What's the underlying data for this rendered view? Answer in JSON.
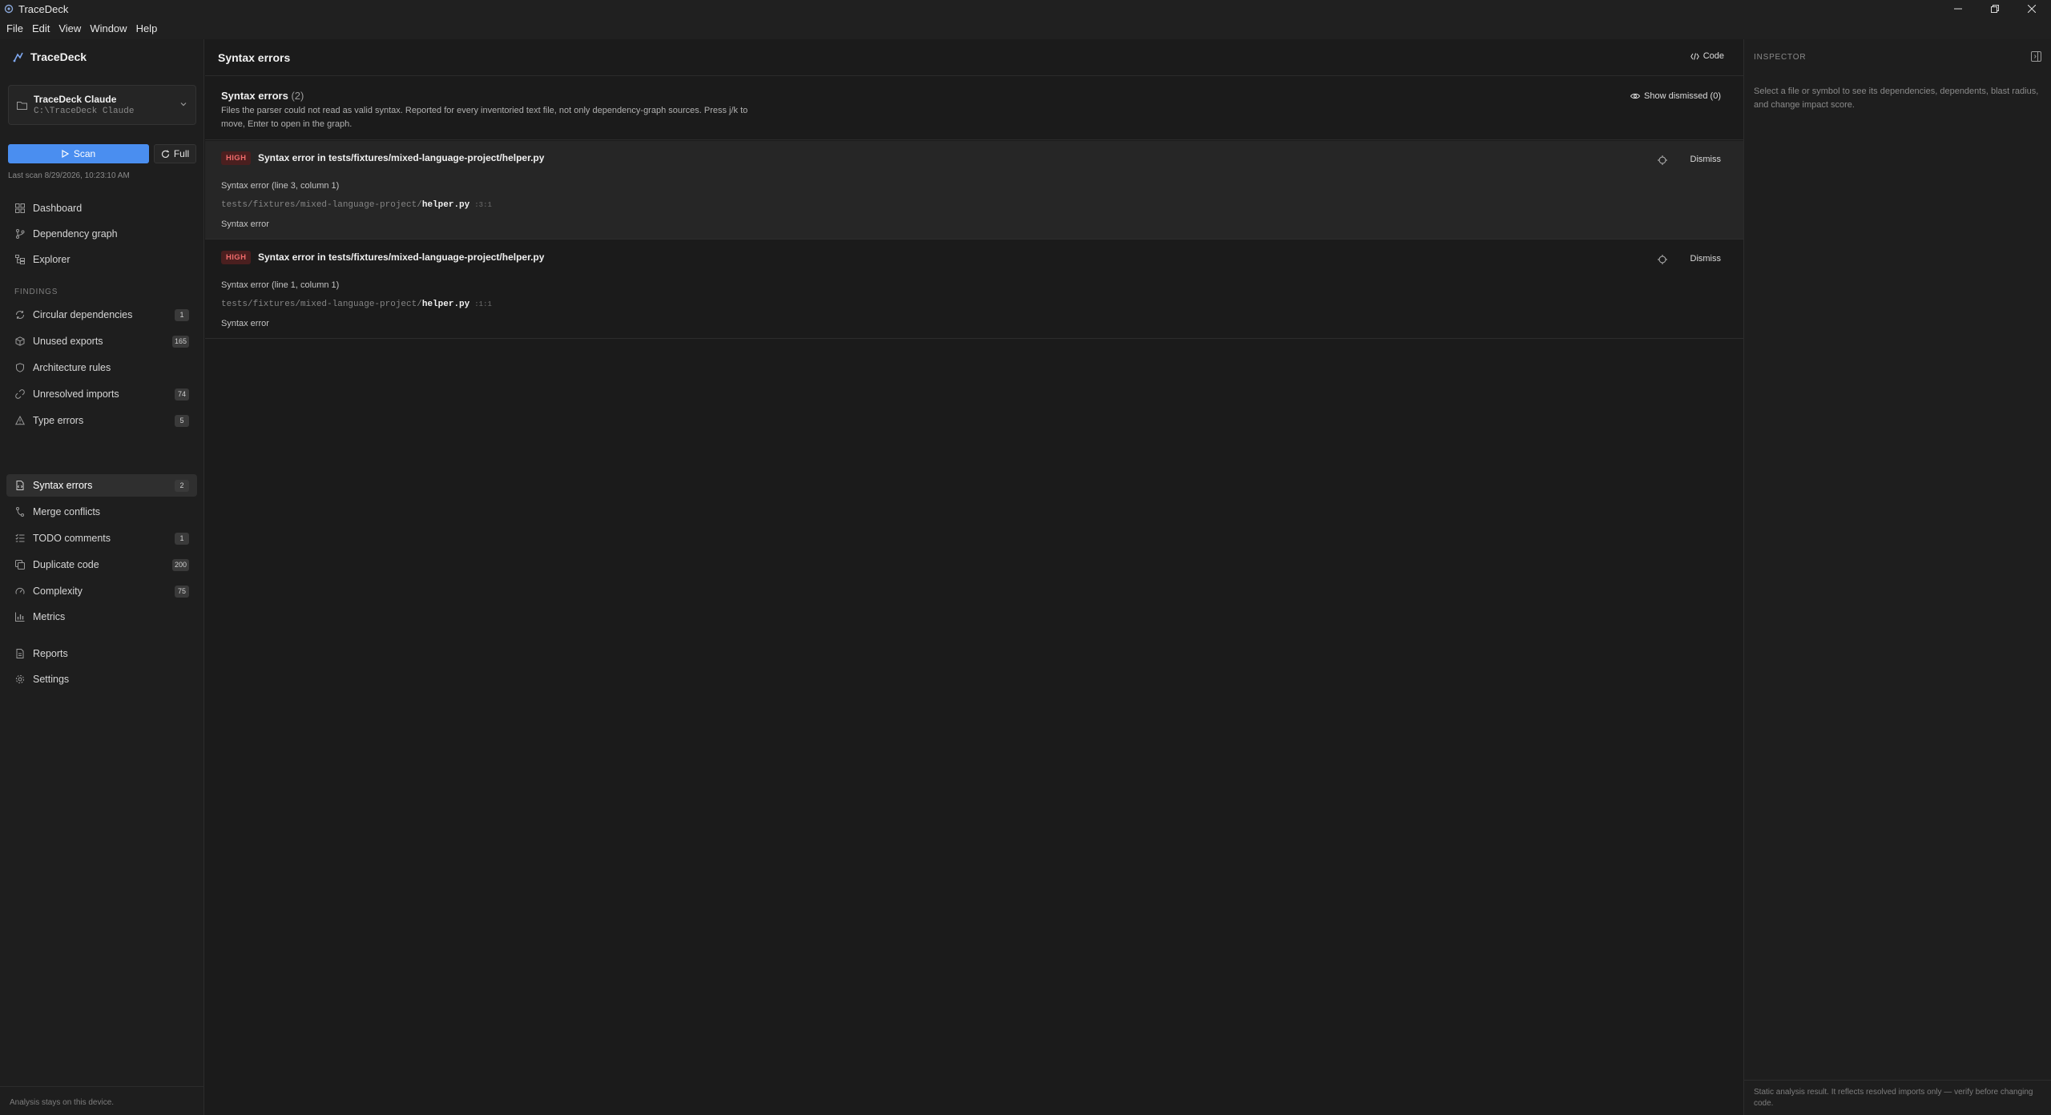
{
  "window": {
    "title": "TraceDeck"
  },
  "menu": [
    "File",
    "Edit",
    "View",
    "Window",
    "Help"
  ],
  "sidebar": {
    "brand": "TraceDeck",
    "project": {
      "name": "TraceDeck Claude",
      "path": "C:\\TraceDeck Claude"
    },
    "scan_label": "Scan",
    "full_label": "Full",
    "last_scan": "Last scan 8/29/2026, 10:23:10 AM",
    "nav_top": [
      {
        "label": "Dashboard",
        "icon": "dashboard-icon"
      },
      {
        "label": "Dependency graph",
        "icon": "branch-icon"
      },
      {
        "label": "Explorer",
        "icon": "tree-icon"
      }
    ],
    "findings_label": "FINDINGS",
    "findings": [
      {
        "label": "Circular dependencies",
        "badge": "1",
        "icon": "cycle-icon"
      },
      {
        "label": "Unused exports",
        "badge": "165",
        "icon": "package-icon"
      },
      {
        "label": "Architecture rules",
        "badge": "",
        "icon": "shield-icon"
      },
      {
        "label": "Unresolved imports",
        "badge": "74",
        "icon": "link-broken-icon"
      },
      {
        "label": "Type errors",
        "badge": "5",
        "icon": "warning-icon"
      },
      {
        "label": "Syntax errors",
        "badge": "2",
        "icon": "file-code-icon"
      },
      {
        "label": "Merge conflicts",
        "badge": "",
        "icon": "merge-icon"
      },
      {
        "label": "TODO comments",
        "badge": "1",
        "icon": "list-todo-icon"
      },
      {
        "label": "Duplicate code",
        "badge": "200",
        "icon": "copy-icon"
      },
      {
        "label": "Complexity",
        "badge": "75",
        "icon": "gauge-icon"
      },
      {
        "label": "Metrics",
        "badge": "",
        "icon": "bar-chart-icon"
      }
    ],
    "nav_bottom": [
      {
        "label": "Reports",
        "icon": "report-icon"
      },
      {
        "label": "Settings",
        "icon": "gear-icon"
      }
    ],
    "footer": "Analysis stays on this device."
  },
  "main": {
    "title": "Syntax errors",
    "code_label": "Code",
    "summary": {
      "title": "Syntax errors",
      "count": "(2)",
      "description": "Files the parser could not read as valid syntax. Reported for every inventoried text file, not only dependency-graph sources. Press j/k to move, Enter to open in the graph.",
      "show_dismissed": "Show dismissed (0)"
    },
    "findings": [
      {
        "severity": "HIGH",
        "title": "Syntax error in tests/fixtures/mixed-language-project/helper.py",
        "line": "Syntax error (line 3, column 1)",
        "path_dir": "tests/fixtures/mixed-language-project/",
        "path_file": "helper.py",
        "position": ":3:1",
        "message": "Syntax error",
        "dismiss": "Dismiss"
      },
      {
        "severity": "HIGH",
        "title": "Syntax error in tests/fixtures/mixed-language-project/helper.py",
        "line": "Syntax error (line 1, column 1)",
        "path_dir": "tests/fixtures/mixed-language-project/",
        "path_file": "helper.py",
        "position": ":1:1",
        "message": "Syntax error",
        "dismiss": "Dismiss"
      }
    ]
  },
  "inspector": {
    "label": "INSPECTOR",
    "hint": "Select a file or symbol to see its dependencies, dependents, blast radius, and change impact score.",
    "footer": "Static analysis result. It reflects resolved imports only — verify before changing code."
  },
  "colors": {
    "accent": "#4a8ef0",
    "severity_high_bg": "#4a1f1f",
    "severity_high_fg": "#f06b6b"
  }
}
